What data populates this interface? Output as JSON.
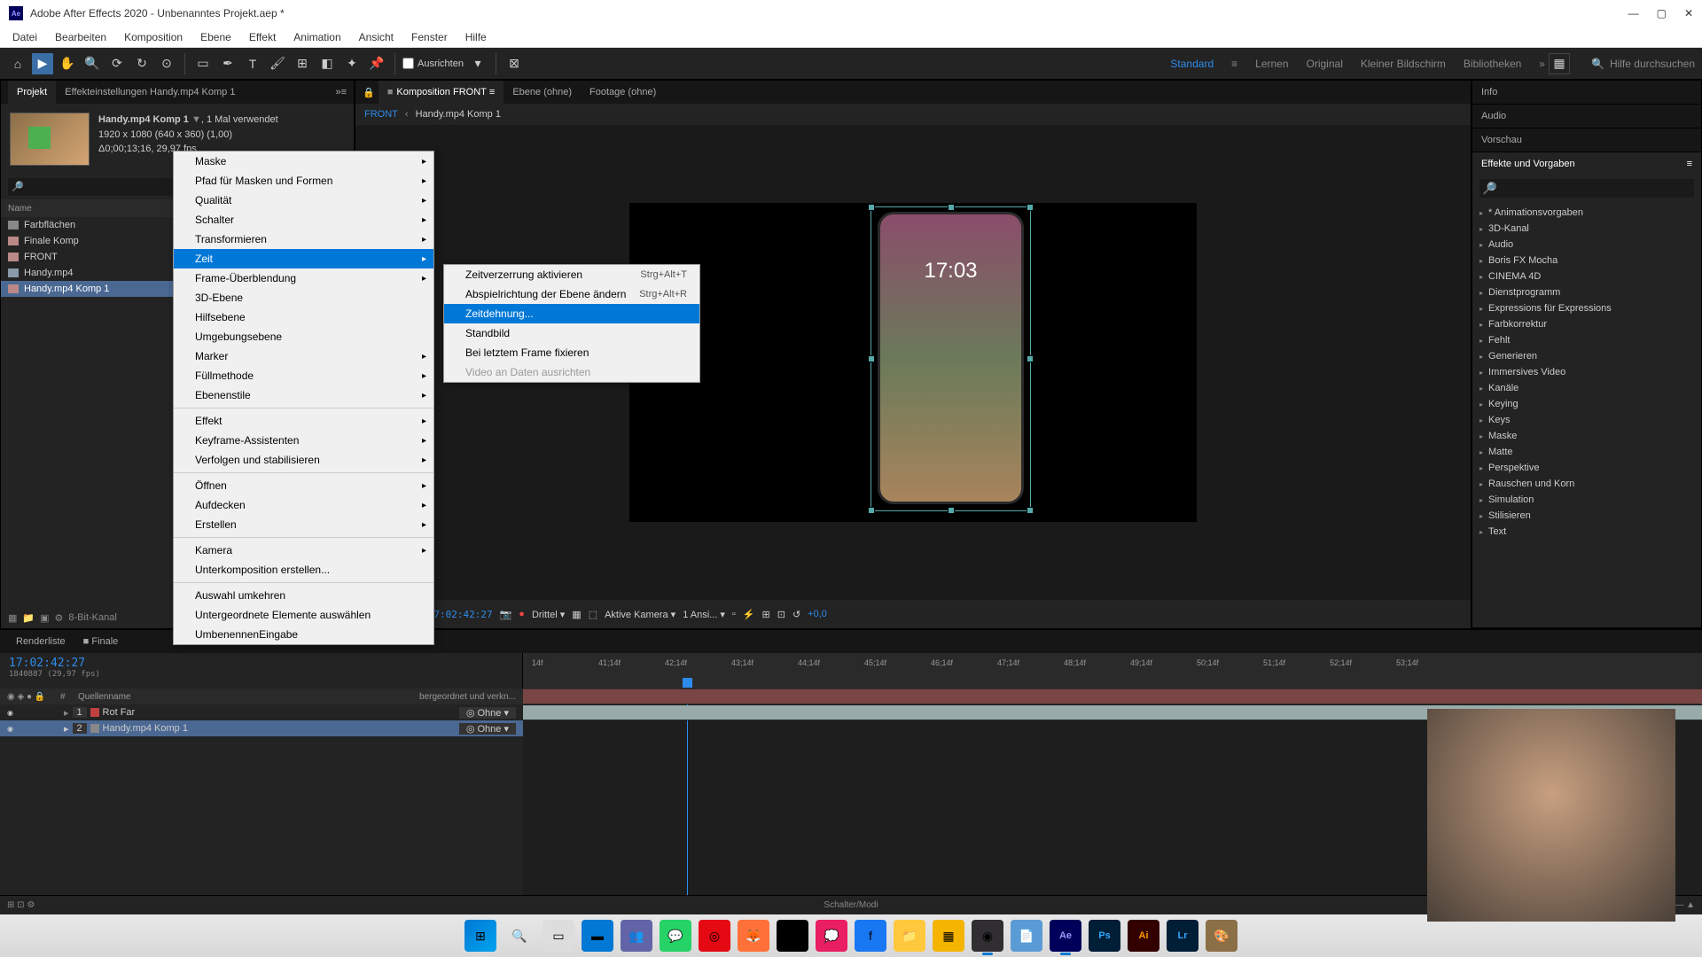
{
  "titlebar": {
    "app_name": "Adobe After Effects 2020",
    "project_name": "Unbenanntes Projekt.aep *",
    "ae_logo": "Ae"
  },
  "menubar": {
    "items": [
      "Datei",
      "Bearbeiten",
      "Komposition",
      "Ebene",
      "Effekt",
      "Animation",
      "Ansicht",
      "Fenster",
      "Hilfe"
    ]
  },
  "toolbar": {
    "checkbox_label": "Ausrichten",
    "workspaces": [
      "Standard",
      "Lernen",
      "Original",
      "Kleiner Bildschirm",
      "Bibliotheken"
    ],
    "workspace_active": "Standard",
    "search_placeholder": "Hilfe durchsuchen"
  },
  "project_panel": {
    "tab_project": "Projekt",
    "tab_effects": "Effekteinstellungen  Handy.mp4 Komp 1",
    "item_name": "Handy.mp4 Komp 1",
    "item_usage": ", 1 Mal verwendet",
    "item_dims": "1920 x 1080 (640 x 360) (1,00)",
    "item_duration": "Δ0;00;13;16, 29,97 fps",
    "list_header": "Name",
    "items": [
      {
        "name": "Farbflächen",
        "type": "folder"
      },
      {
        "name": "Finale Komp",
        "type": "comp"
      },
      {
        "name": "FRONT",
        "type": "comp"
      },
      {
        "name": "Handy.mp4",
        "type": "footage"
      },
      {
        "name": "Handy.mp4 Komp 1",
        "type": "comp",
        "selected": true
      }
    ],
    "footer_depth": "8-Bit-Kanal"
  },
  "composition": {
    "tab_prefix_komposition": "Komposition",
    "tab_comp_name": "FRONT",
    "tab_ebene": "Ebene (ohne)",
    "tab_footage": "Footage (ohne)",
    "breadcrumb": [
      "FRONT",
      "Handy.mp4 Komp 1"
    ],
    "phone_time": "17:03",
    "controls": {
      "timecode": "17:02:42:27",
      "zoom_label": "Drittel",
      "camera": "Aktive Kamera",
      "views": "1 Ansi...",
      "exposure": "+0,0"
    }
  },
  "right_panels": {
    "info": "Info",
    "audio": "Audio",
    "preview": "Vorschau",
    "effects_presets": "Effekte und Vorgaben",
    "effects_items": [
      "* Animationsvorgaben",
      "3D-Kanal",
      "Audio",
      "Boris FX Mocha",
      "CINEMA 4D",
      "Dienstprogramm",
      "Expressions für Expressions",
      "Farbkorrektur",
      "Fehlt",
      "Generieren",
      "Immersives Video",
      "Kanäle",
      "Keying",
      "Keys",
      "Maske",
      "Matte",
      "Perspektive",
      "Rauschen und Korn",
      "Simulation",
      "Stilisieren",
      "Text"
    ]
  },
  "timeline": {
    "tab_renderlist": "Renderliste",
    "tab_finale": "Finale",
    "timecode": "17:02:42:27",
    "timecode_small": "1840887 (29,97 fps)",
    "header_source": "Quellenname",
    "header_mode_prefix": "bergeordnet und verkn...",
    "ruler_marks": [
      "14f",
      "41;14f",
      "42;14f",
      "43;14f",
      "44;14f",
      "45;14f",
      "46;14f",
      "47;14f",
      "48;14f",
      "49;14f",
      "50;14f",
      "51;14f",
      "52;14f",
      "53;14f"
    ],
    "layers": [
      {
        "num": "1",
        "name": "Rot Far",
        "color": "#c04040",
        "mode": "Ohne"
      },
      {
        "num": "2",
        "name": "Handy.mp4 Komp 1",
        "color": "#888",
        "mode": "Ohne",
        "selected": true
      }
    ]
  },
  "context_menu": {
    "items": [
      {
        "label": "Maske",
        "submenu": true
      },
      {
        "label": "Pfad für Masken und Formen",
        "submenu": true
      },
      {
        "label": "Qualität",
        "submenu": true
      },
      {
        "label": "Schalter",
        "submenu": true
      },
      {
        "label": "Transformieren",
        "submenu": true
      },
      {
        "label": "Zeit",
        "submenu": true,
        "highlighted": true
      },
      {
        "label": "Frame-Überblendung",
        "submenu": true
      },
      {
        "label": "3D-Ebene"
      },
      {
        "label": "Hilfsebene"
      },
      {
        "label": "Umgebungsebene"
      },
      {
        "label": "Marker",
        "submenu": true
      },
      {
        "label": "Füllmethode",
        "submenu": true
      },
      {
        "label": "Ebenenstile",
        "submenu": true
      },
      {
        "sep": true
      },
      {
        "label": "Effekt",
        "submenu": true
      },
      {
        "label": "Keyframe-Assistenten",
        "submenu": true
      },
      {
        "label": "Verfolgen und stabilisieren",
        "submenu": true
      },
      {
        "sep": true
      },
      {
        "label": "Öffnen",
        "submenu": true
      },
      {
        "label": "Aufdecken",
        "submenu": true
      },
      {
        "label": "Erstellen",
        "submenu": true
      },
      {
        "sep": true
      },
      {
        "label": "Kamera",
        "submenu": true
      },
      {
        "label": "Unterkomposition erstellen..."
      },
      {
        "sep": true
      },
      {
        "label": "Auswahl umkehren"
      },
      {
        "label": "Untergeordnete Elemente auswählen"
      },
      {
        "label": "Umbenennen",
        "shortcut": "Eingabe"
      }
    ],
    "submenu_items": [
      {
        "label": "Zeitverzerrung aktivieren",
        "shortcut": "Strg+Alt+T"
      },
      {
        "label": "Abspielrichtung der Ebene ändern",
        "shortcut": "Strg+Alt+R"
      },
      {
        "label": "Zeitdehnung...",
        "highlighted": true
      },
      {
        "label": "Standbild"
      },
      {
        "label": "Bei letztem Frame fixieren"
      },
      {
        "label": "Video an Daten ausrichten",
        "disabled": true
      }
    ]
  },
  "status_bar": {
    "center_text": "Schalter/Modi"
  }
}
